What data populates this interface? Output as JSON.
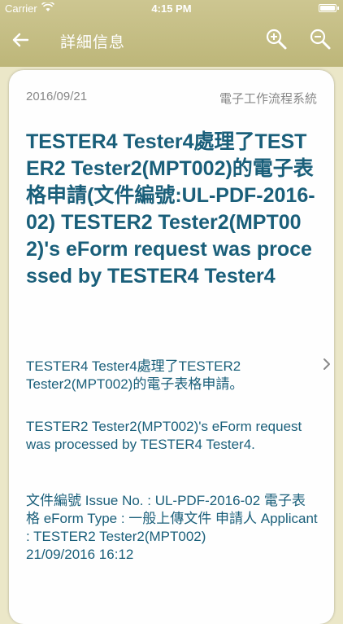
{
  "status_bar": {
    "carrier": "Carrier",
    "time": "4:15 PM"
  },
  "nav": {
    "title": "詳細信息"
  },
  "icons": {
    "back": "arrow-left-icon",
    "zoom_in": "zoom-in-icon",
    "zoom_out": "zoom-out-icon",
    "next": "chevron-right-icon"
  },
  "colors": {
    "header": "#c4bd82",
    "accent_text": "#1a5f7a"
  },
  "card": {
    "date": "2016/09/21",
    "source": "電子工作流程系統",
    "title": "TESTER4 Tester4處理了TESTER2 Tester2(MPT002)的電子表格申請(文件編號:UL-PDF-2016-02) TESTER2 Tester2(MPT002)'s eForm request was processed by TESTER4 Tester4",
    "paragraph1": "TESTER4 Tester4處理了TESTER2 Tester2(MPT002)的電子表格申請。",
    "paragraph2": "TESTER2 Tester2(MPT002)'s eForm request was processed by TESTER4 Tester4.",
    "paragraph3_line1": "文件編號 Issue No. : UL-PDF-2016-02 電子表格 eForm Type : 一般上傳文件 申請人 Applicant : TESTER2 Tester2(MPT002)",
    "paragraph3_line2": "21/09/2016 16:12"
  }
}
